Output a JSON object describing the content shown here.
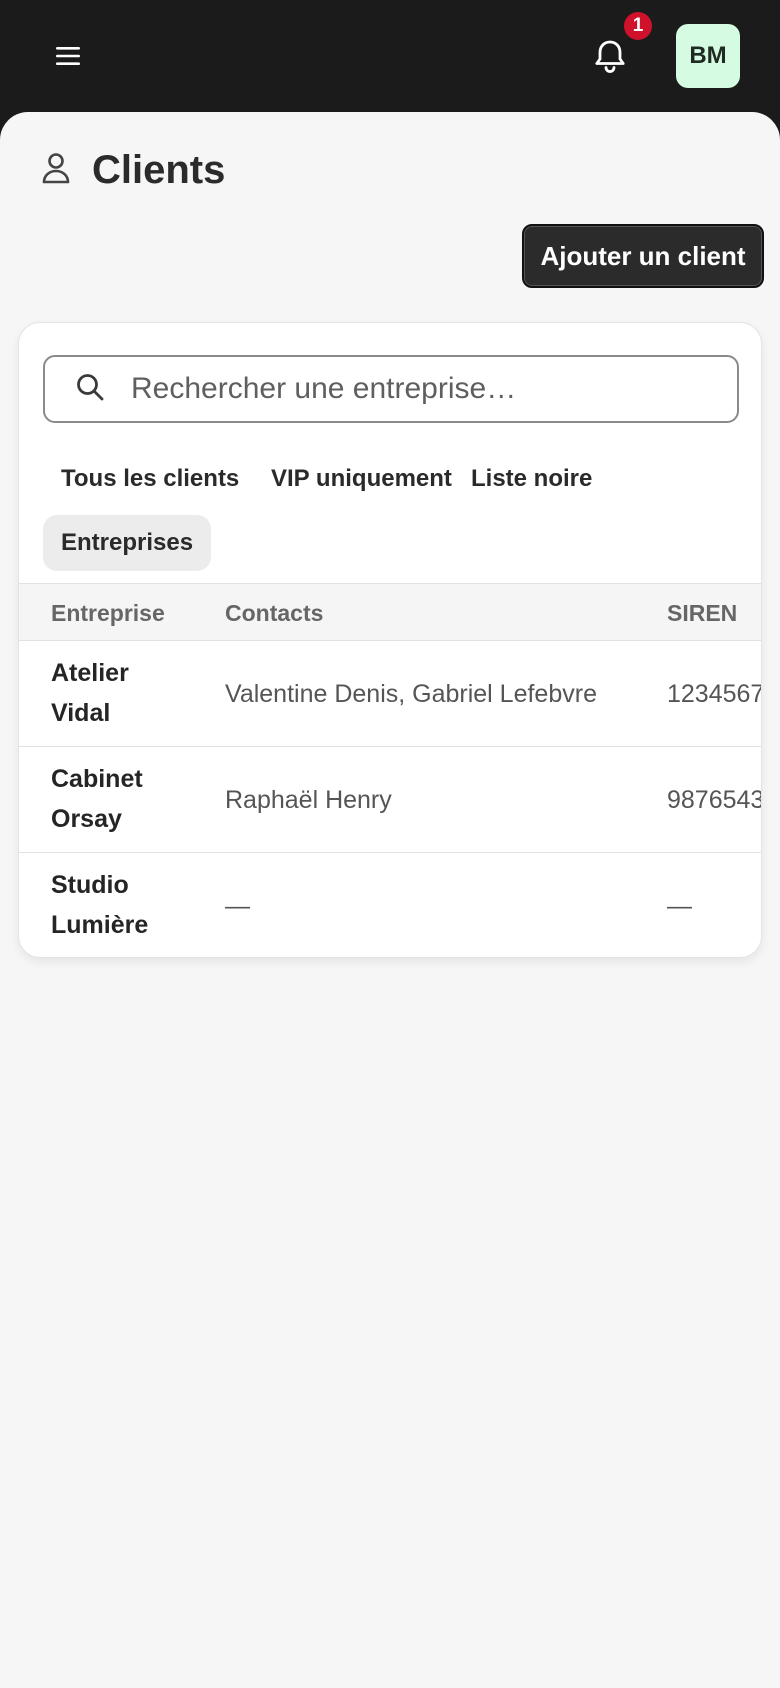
{
  "topbar": {
    "menu_icon": "hamburger-menu-icon",
    "bell_icon": "bell-icon",
    "notification_count": "1",
    "avatar_initials": "BM",
    "avatar_color": "#d6fbe3",
    "badge_color": "#d0112b"
  },
  "page": {
    "icon": "user-icon",
    "title": "Clients",
    "add_button": "Ajouter un client"
  },
  "search": {
    "icon": "search-icon",
    "placeholder": "Rechercher une entreprise…",
    "value": ""
  },
  "filters": [
    {
      "label": "Tous les clients",
      "active": false
    },
    {
      "label": "VIP uniquement",
      "active": false
    },
    {
      "label": "Liste noire",
      "active": false
    },
    {
      "label": "Entreprises",
      "active": true
    }
  ],
  "table": {
    "columns": [
      "Entreprise",
      "Contacts",
      "SIREN"
    ],
    "rows": [
      {
        "company": "Atelier Vidal",
        "contacts": "Valentine Denis, Gabriel Lefebvre",
        "siren": "1234567"
      },
      {
        "company": "Cabinet Orsay",
        "contacts": "Raphaël Henry",
        "siren": "9876543"
      },
      {
        "company": "Studio Lumière",
        "contacts": "—",
        "siren": "—"
      }
    ]
  }
}
